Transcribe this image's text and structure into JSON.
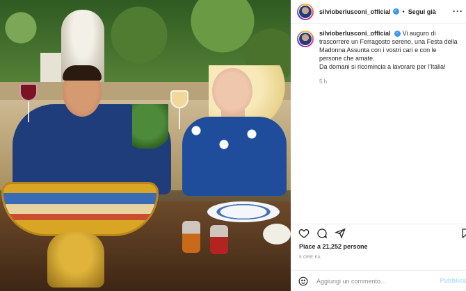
{
  "post": {
    "username": "silvioberlusconi_official",
    "follow_label": "Segui già",
    "more_label": "···",
    "caption": "Vi auguro di trascorrere un Ferragosto sereno, una Festa della Madonna Assunta con i vostri cari e con le persone che amate.",
    "caption_line2": "Da domani si ricomincia a lavorare per l’Italia!",
    "caption_time": "5 h",
    "likes": "Piace a 21,252 persone",
    "date": "5 ORE FA"
  },
  "comment": {
    "placeholder": "Aggiungi un commento...",
    "publish_label": "Pubblica"
  },
  "icons": {
    "verified": "verified-badge-icon",
    "like": "heart-icon",
    "comment": "comment-icon",
    "share": "send-icon",
    "save": "bookmark-icon",
    "emoji": "emoji-icon"
  },
  "colors": {
    "verified": "#3897f0",
    "muted": "#8e8e8e",
    "publish": "#b2dffc"
  }
}
